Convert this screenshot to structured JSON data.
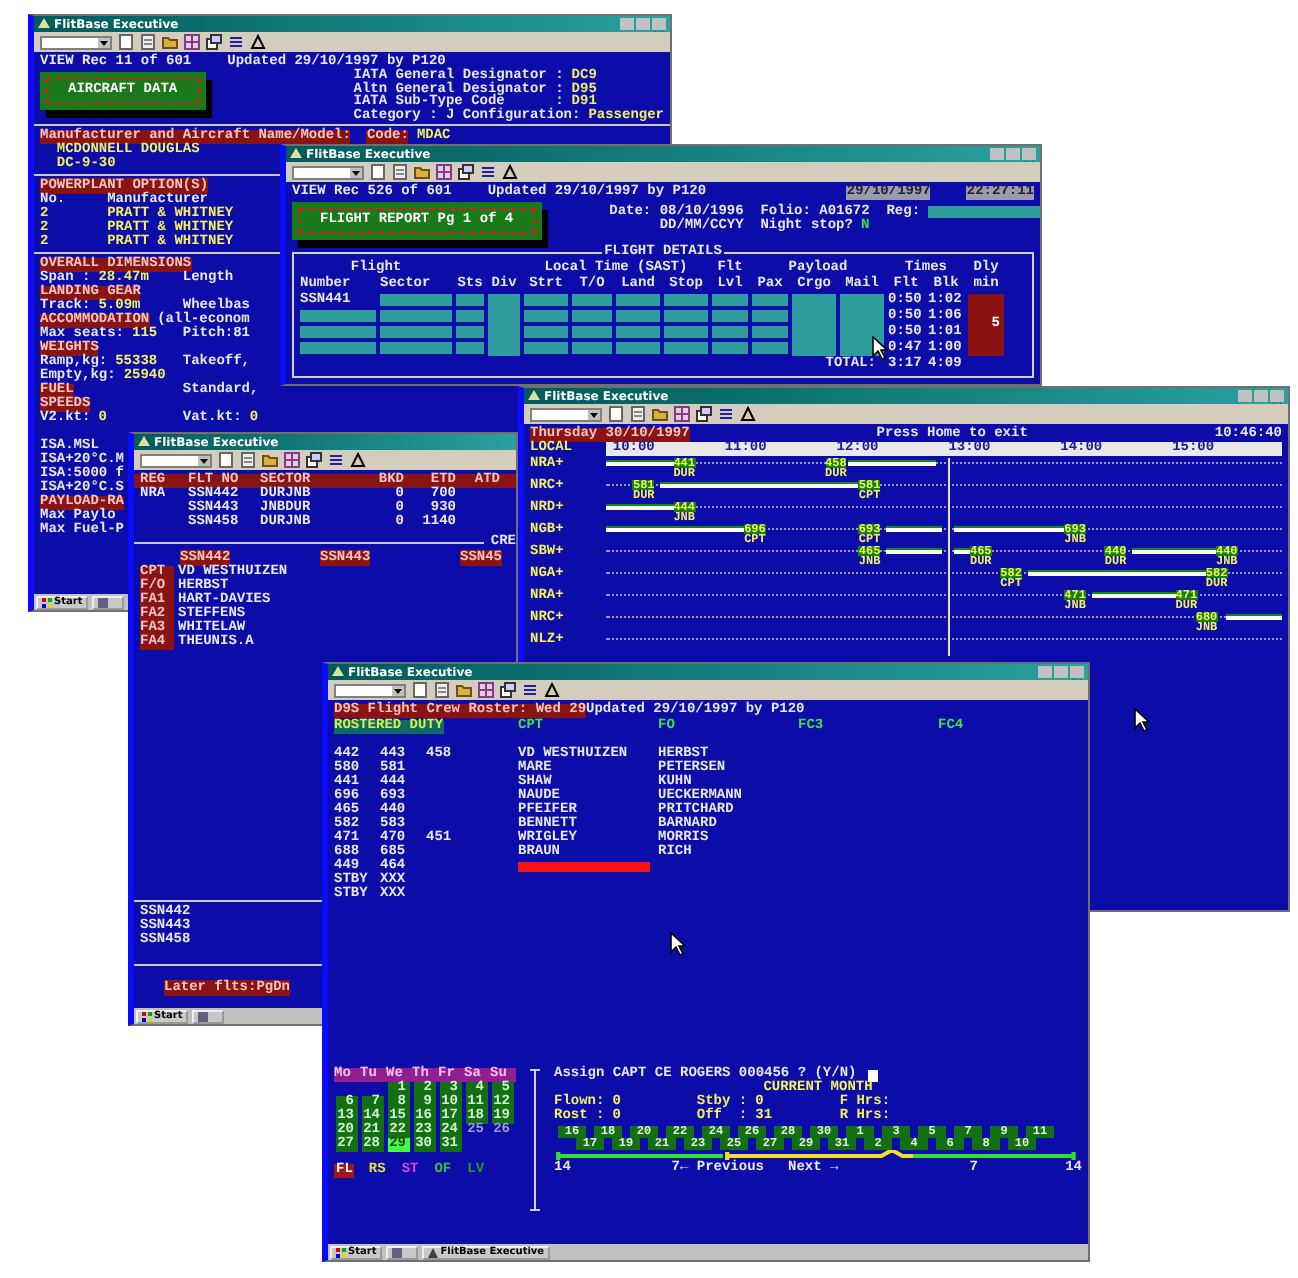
{
  "windows": [
    {
      "kind": "aircraft",
      "title": "FlitBase Executive",
      "record": "VIEW Rec 11 of 601",
      "updated": "Updated 29/10/1997 by P120",
      "heading": "AIRCRAFT DATA",
      "designators": [
        {
          "label": "IATA General Designator :",
          "value": "DC9"
        },
        {
          "label": "Altn General Designator :",
          "value": "D95"
        },
        {
          "label": "IATA Sub-Type Code      :",
          "value": "D91"
        }
      ],
      "category": {
        "label": "Category : J Configuration:",
        "value": "Passenger"
      },
      "manufacturer": {
        "label": "Manufacturer and Aircraft Name/Model:",
        "code_label": "Code:",
        "code": "MDAC",
        "name": "MCDONNELL DOUGLAS",
        "model": "DC-9-30"
      },
      "powerplant": {
        "heading": "POWERPLANT OPTION(S)",
        "columns": [
          "No.",
          "Manufacturer"
        ],
        "rows": [
          [
            "2",
            "PRATT & WHITNEY"
          ],
          [
            "2",
            "PRATT & WHITNEY"
          ],
          [
            "2",
            "PRATT & WHITNEY"
          ]
        ]
      },
      "sections": [
        {
          "kind": "heading",
          "text": "OVERALL DIMENSIONS"
        },
        {
          "kind": "field",
          "label": "Span :",
          "value": "28.47m",
          "right": "Length"
        },
        {
          "kind": "heading",
          "text": "LANDING GEAR"
        },
        {
          "kind": "field",
          "label": "Track:",
          "value": "5.09m",
          "right": "Wheelbas"
        },
        {
          "kind": "heading",
          "text": "ACCOMMODATION",
          "note": "(all-econom"
        },
        {
          "kind": "field",
          "label": "Max seats:",
          "value": "115",
          "right": "Pitch:81"
        },
        {
          "kind": "heading",
          "text": "WEIGHTS"
        },
        {
          "kind": "field",
          "label": "Ramp,kg:",
          "value": "55338",
          "right": "Takeoff,"
        },
        {
          "kind": "field",
          "label": "Empty,kg:",
          "value": "25940"
        },
        {
          "kind": "heading",
          "text": "FUEL",
          "right": "Standard,"
        },
        {
          "kind": "heading",
          "text": "SPEEDS"
        },
        {
          "kind": "field",
          "label": "V2.kt:",
          "value": "0",
          "right": "Vat.kt:",
          "right_value": "0"
        },
        {
          "kind": "gap"
        },
        {
          "kind": "line",
          "text": "ISA.MSL"
        },
        {
          "kind": "line",
          "text": "ISA+20°C.M"
        },
        {
          "kind": "line",
          "text": "ISA:5000 f"
        },
        {
          "kind": "line",
          "text": "ISA+20°C.S"
        },
        {
          "kind": "heading",
          "text": "PAYLOAD-RA"
        },
        {
          "kind": "line",
          "text": "Max Paylo"
        },
        {
          "kind": "line",
          "text": "Max Fuel-P"
        }
      ],
      "taskbar": {
        "start": "Start"
      }
    },
    {
      "kind": "flight_report",
      "title": "FlitBase Executive",
      "record": "VIEW Rec 526 of 601",
      "updated": "Updated 29/10/1997 by P120",
      "date_stamp": "29/10/1997",
      "time_stamp": "22:27:11",
      "heading": "FLIGHT REPORT Pg 1 of 4",
      "date": {
        "label": "Date:",
        "value": "08/10/1996",
        "hint": "DD/MM/CCYY"
      },
      "folio": {
        "label": "Folio:",
        "value": "A01672"
      },
      "reg": {
        "label": "Reg:"
      },
      "night_stop": {
        "label": "Night stop?",
        "value": "N"
      },
      "details": {
        "title": "FLIGHT DETAILS",
        "groups": [
          "Flight",
          "Local Time (SAST)",
          "Flt",
          "Payload",
          "Times",
          "Dly"
        ],
        "columns": [
          "Number",
          "Sector",
          "Sts",
          "Div",
          "Strt",
          "T/O",
          "Land",
          "Stop",
          "Lvl",
          "Pax",
          "Crgo",
          "Mail",
          "Flt",
          "Blk",
          "min"
        ],
        "rows": [
          {
            "number": "SSN441",
            "flt": "0:50",
            "blk": "1:02"
          },
          {
            "flt": "0:50",
            "blk": "1:06"
          },
          {
            "flt": "0:50",
            "blk": "1:01"
          },
          {
            "flt": "0:47",
            "blk": "1:00"
          }
        ],
        "delay": "5",
        "total_label": "TOTAL:",
        "total_flt": "3:17",
        "total_blk": "4:09"
      }
    },
    {
      "kind": "crew_list",
      "title": "FlitBase Executive",
      "columns": [
        "REG",
        "FLT NO",
        "SECTOR",
        "BKD",
        "ETD",
        "ATD"
      ],
      "flights": [
        {
          "reg": "NRA",
          "flight": "SSN442",
          "sector": "DURJNB",
          "bkd": "0",
          "etd": "700"
        },
        {
          "flight": "SSN443",
          "sector": "JNBDUR",
          "bkd": "0",
          "etd": "930"
        },
        {
          "flight": "SSN458",
          "sector": "DURJNB",
          "bkd": "0",
          "etd": "1140"
        }
      ],
      "crew_label": "CRE",
      "crew_flights": [
        "SSN442",
        "SSN443",
        "SSN45"
      ],
      "crew": [
        {
          "role": "CPT",
          "name": "VD WESTHUIZEN"
        },
        {
          "role": "F/O",
          "name": "HERBST"
        },
        {
          "role": "FA1",
          "name": "HART-DAVIES"
        },
        {
          "role": "FA2",
          "name": "STEFFENS"
        },
        {
          "role": "FA3",
          "name": "WHITELAW"
        },
        {
          "role": "FA4",
          "name": "THEUNIS.A"
        }
      ],
      "later_flights": [
        "SSN442",
        "SSN443",
        "SSN458"
      ],
      "footer": "Later flts:PgDn",
      "taskbar": {
        "start": "Start"
      }
    },
    {
      "kind": "gantt",
      "title": "FlitBase Executive",
      "day": "Thursday 30/10/1997",
      "hint": "Press Home to exit",
      "clock": "10:46:40",
      "scale_label": "LOCAL",
      "hours": [
        "10:00",
        "11:00",
        "12:00",
        "13:00",
        "14:00",
        "15:00"
      ],
      "rows": [
        {
          "label": "NRA+",
          "flights": [
            {
              "number": "441",
              "port": "DUR"
            },
            {
              "number": "458",
              "port": "DUR"
            }
          ]
        },
        {
          "label": "NRC+",
          "flights": [
            {
              "number": "581",
              "port": "DUR"
            },
            {
              "number": "581",
              "port": "CPT"
            }
          ]
        },
        {
          "label": "NRD+",
          "flights": [
            {
              "number": "444",
              "port": "JNB"
            }
          ]
        },
        {
          "label": "NGB+",
          "flights": [
            {
              "number": "696",
              "port": "CPT"
            },
            {
              "number": "693",
              "port": "CPT"
            },
            {
              "number": "693",
              "port": "JNB"
            }
          ]
        },
        {
          "label": "SBW+",
          "flights": [
            {
              "number": "465",
              "port": "JNB"
            },
            {
              "number": "465",
              "port": "DUR"
            },
            {
              "number": "440",
              "port": "DUR"
            },
            {
              "number": "440",
              "port": "JNB"
            }
          ]
        },
        {
          "label": "NGA+",
          "flights": [
            {
              "number": "582",
              "port": "CPT"
            },
            {
              "number": "582",
              "port": "DUR"
            }
          ]
        },
        {
          "label": "NRA+",
          "flights": [
            {
              "number": "471",
              "port": "JNB"
            },
            {
              "number": "471",
              "port": "DUR"
            }
          ]
        },
        {
          "label": "NRC+",
          "flights": [
            {
              "number": "680",
              "port": "JNB"
            }
          ]
        },
        {
          "label": "NLZ+",
          "flights": []
        }
      ]
    },
    {
      "kind": "roster",
      "title": "FlitBase Executive",
      "heading": "D9S Flight Crew Roster: Wed 29",
      "updated": "Updated 29/10/1997 by P120",
      "duty_label": "ROSTERED DUTY",
      "ranks": [
        "CPT",
        "FO",
        "FC3",
        "FC4"
      ],
      "rows": [
        {
          "duty": [
            "442",
            "443",
            "458"
          ],
          "cpt": "VD WESTHUIZEN",
          "fo": "HERBST",
          "selected": false
        },
        {
          "duty": [
            "580",
            "581"
          ],
          "cpt": "MARE",
          "fo": "PETERSEN",
          "selected": false
        },
        {
          "duty": [
            "441",
            "444"
          ],
          "cpt": "SHAW",
          "fo": "KUHN",
          "selected": false
        },
        {
          "duty": [
            "696",
            "693"
          ],
          "cpt": "NAUDE",
          "fo": "UECKERMANN",
          "selected": false
        },
        {
          "duty": [
            "465",
            "440"
          ],
          "cpt": "PFEIFER",
          "fo": "PRITCHARD",
          "selected": false
        },
        {
          "duty": [
            "582",
            "583"
          ],
          "cpt": "BENNETT",
          "fo": "BARNARD",
          "selected": false
        },
        {
          "duty": [
            "471",
            "470",
            "451"
          ],
          "cpt": "WRIGLEY",
          "fo": "MORRIS",
          "selected": false
        },
        {
          "duty": [
            "688",
            "685"
          ],
          "cpt": "BRAUN",
          "fo": "RICH",
          "selected": false
        },
        {
          "duty": [
            "449",
            "464"
          ],
          "selected": true
        },
        {
          "duty": [
            "STBY",
            "XXX"
          ],
          "selected": false
        },
        {
          "duty": [
            "STBY",
            "XXX"
          ],
          "selected": false
        }
      ],
      "weekdays": [
        "Mo",
        "Tu",
        "We",
        "Th",
        "Fr",
        "Sa",
        "Su"
      ],
      "weeks": [
        {
          "kind": "first",
          "days": [
            {
              "label": "1",
              "rostered": true,
              "selected": false
            },
            {
              "label": "2",
              "rostered": true,
              "selected": false
            },
            {
              "label": "3",
              "rostered": true,
              "selected": false
            },
            {
              "label": "4",
              "rostered": true,
              "selected": false
            },
            {
              "label": "5",
              "rostered": true,
              "selected": false
            }
          ]
        },
        {
          "kind": "full",
          "days": [
            {
              "label": "6",
              "rostered": true,
              "selected": false
            },
            {
              "label": "7",
              "rostered": true,
              "selected": false
            },
            {
              "label": "8",
              "rostered": true,
              "selected": false
            },
            {
              "label": "9",
              "rostered": true,
              "selected": false
            },
            {
              "label": "10",
              "rostered": true,
              "selected": false
            },
            {
              "label": "11",
              "rostered": true,
              "selected": false
            },
            {
              "label": "12",
              "rostered": true,
              "selected": false
            }
          ]
        },
        {
          "kind": "full",
          "days": [
            {
              "label": "13",
              "rostered": true,
              "selected": false
            },
            {
              "label": "14",
              "rostered": true,
              "selected": false
            },
            {
              "label": "15",
              "rostered": true,
              "selected": false
            },
            {
              "label": "16",
              "rostered": true,
              "selected": false
            },
            {
              "label": "17",
              "rostered": true,
              "selected": false
            },
            {
              "label": "18",
              "rostered": true,
              "selected": false
            },
            {
              "label": "19",
              "rostered": true,
              "selected": false
            }
          ]
        },
        {
          "kind": "full",
          "days": [
            {
              "label": "20",
              "rostered": true,
              "selected": false
            },
            {
              "label": "21",
              "rostered": true,
              "selected": false
            },
            {
              "label": "22",
              "rostered": true,
              "selected": false
            },
            {
              "label": "23",
              "rostered": true,
              "selected": false
            },
            {
              "label": "24",
              "rostered": true,
              "selected": false
            },
            {
              "label": "25",
              "rostered": false,
              "selected": false
            },
            {
              "label": "26",
              "rostered": false,
              "selected": false
            }
          ]
        },
        {
          "kind": "last",
          "days": [
            {
              "label": "27",
              "rostered": true,
              "selected": false
            },
            {
              "label": "28",
              "rostered": true,
              "selected": false
            },
            {
              "label": "29",
              "rostered": true,
              "selected": true
            },
            {
              "label": "30",
              "rostered": true,
              "selected": false
            },
            {
              "label": "31",
              "rostered": true,
              "selected": false
            }
          ]
        }
      ],
      "legend": [
        {
          "code": "FL",
          "kind": "badge",
          "color": "#a01818"
        },
        {
          "code": "RS",
          "kind": "text",
          "color": "#e0e040"
        },
        {
          "code": "ST",
          "kind": "text",
          "color": "#e040e0"
        },
        {
          "code": "OF",
          "kind": "text",
          "color": "#40c040"
        },
        {
          "code": "LV",
          "kind": "text",
          "color": "#20a020"
        }
      ],
      "prompt": "Assign CAPT CE ROGERS 000456 ? (Y/N)",
      "month_title": "CURRENT MONTH",
      "stats": [
        {
          "label": "Flown:",
          "value": "0"
        },
        {
          "label": "Stby :",
          "value": "0"
        },
        {
          "label": "F Hrs:"
        },
        {
          "label": "Rost :",
          "value": "0"
        },
        {
          "label": "Off  :",
          "value": "31"
        },
        {
          "label": "R Hrs:"
        }
      ],
      "strip": [
        "16",
        "17",
        "18",
        "19",
        "20",
        "21",
        "22",
        "23",
        "24",
        "25",
        "26",
        "27",
        "28",
        "29",
        "30",
        "31",
        "1",
        "2",
        "3",
        "4",
        "5",
        "6",
        "7",
        "8",
        "9",
        "10",
        "11"
      ],
      "nav": [
        "14",
        "7← Previous",
        "Next →",
        "7",
        "14"
      ],
      "taskbar": {
        "start": "Start",
        "tasks": [
          "FlitBase Executive"
        ]
      }
    }
  ]
}
